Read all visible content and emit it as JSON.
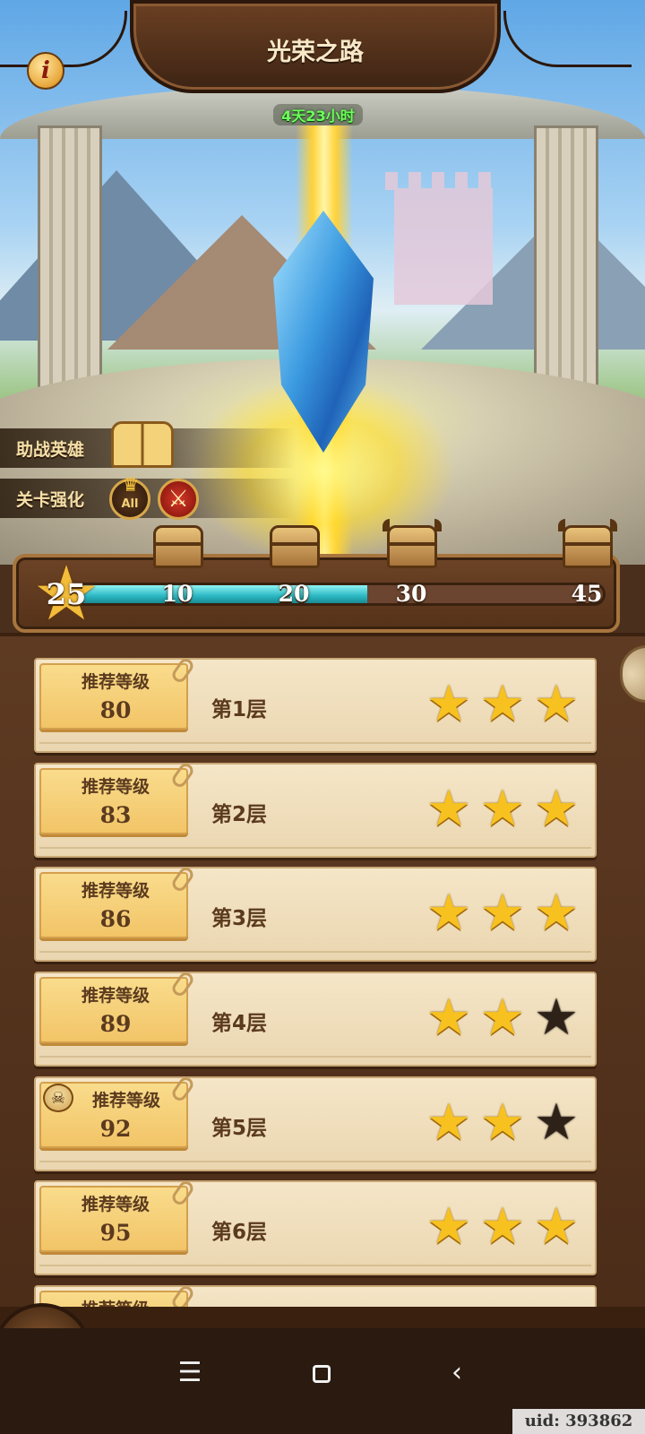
{
  "header": {
    "title": "光荣之路",
    "timer": "4天23小时",
    "info_icon": "i"
  },
  "side_menu": {
    "helper_heroes_label": "助战英雄",
    "stage_boost_label": "关卡强化",
    "stage_boost_badge": "All"
  },
  "progress": {
    "current_stars": "25",
    "max_stars": 45,
    "milestones": [
      {
        "value": "10",
        "reward": "treasure-chest",
        "claimed": true
      },
      {
        "value": "20",
        "reward": "treasure-chest",
        "claimed": true
      },
      {
        "value": "30",
        "reward": "horned-chest",
        "claimed": false
      },
      {
        "value": "45",
        "reward": "horned-chest",
        "claimed": false
      }
    ],
    "fill_fraction": 0.555,
    "colors": {
      "fill": "#2ab8c3",
      "track": "#6b4530"
    }
  },
  "floors": [
    {
      "level_label": "推荐等级",
      "level": "80",
      "name": "第1层",
      "stars": 3,
      "boss": false
    },
    {
      "level_label": "推荐等级",
      "level": "83",
      "name": "第2层",
      "stars": 3,
      "boss": false
    },
    {
      "level_label": "推荐等级",
      "level": "86",
      "name": "第3层",
      "stars": 3,
      "boss": false
    },
    {
      "level_label": "推荐等级",
      "level": "89",
      "name": "第4层",
      "stars": 2,
      "boss": false
    },
    {
      "level_label": "推荐等级",
      "level": "92",
      "name": "第5层",
      "stars": 2,
      "boss": true
    },
    {
      "level_label": "推荐等级",
      "level": "95",
      "name": "第6层",
      "stars": 3,
      "boss": false
    }
  ],
  "partial_floor": {
    "level_label": "推荐等级"
  },
  "footer": {
    "uid": "uid: 393862"
  },
  "colors": {
    "star_filled": "#f7c21f",
    "star_empty": "#2e2118",
    "timer_green": "#6dff5a"
  }
}
